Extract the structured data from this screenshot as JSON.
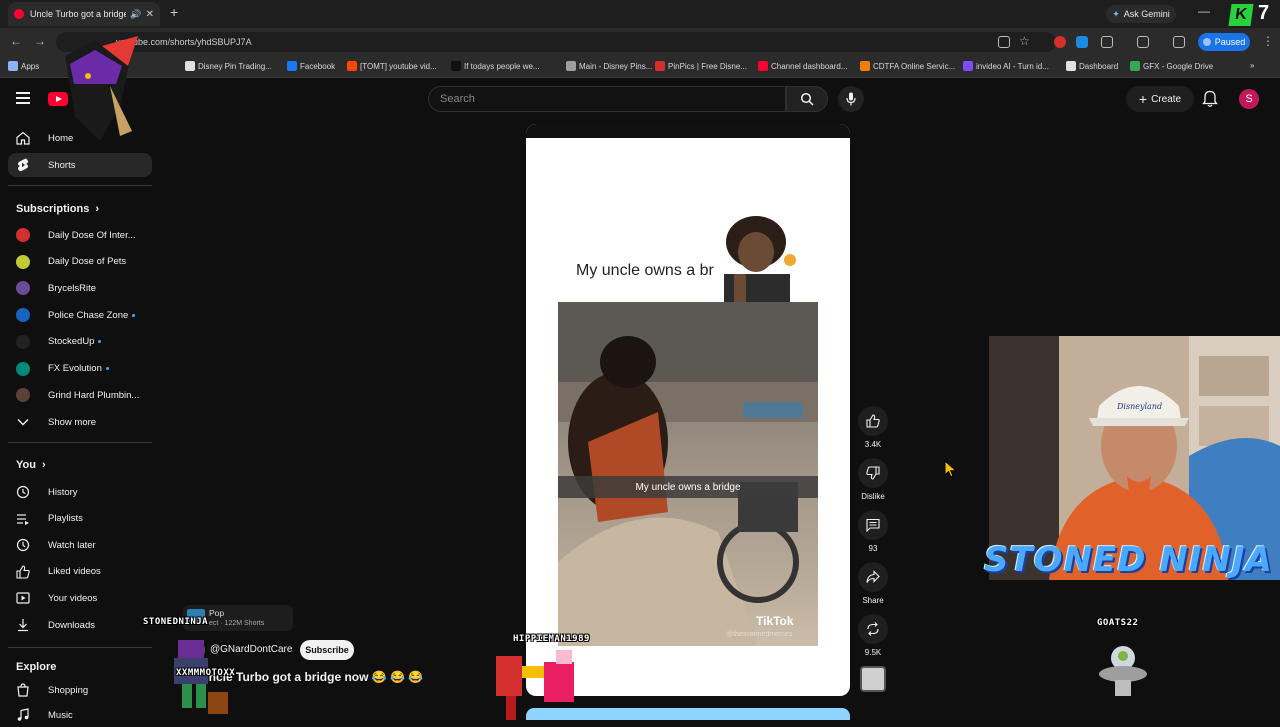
{
  "browser": {
    "tab_title": "Uncle Turbo got a bridge n",
    "new_tab": "+",
    "url": "youtube.com/shorts/yhdSBUPJ7A",
    "ask_gemini": "Ask Gemini",
    "paused_label": "Paused",
    "badge_letter": "K",
    "badge_number": "7"
  },
  "bookmarks": [
    {
      "label": "Apps",
      "color": "#8ab4f8"
    },
    {
      "label": "Disney Pin Trading...",
      "color": "#e0e0e0"
    },
    {
      "label": "Facebook",
      "color": "#1877f2"
    },
    {
      "label": "[TOMT] youtube vid...",
      "color": "#ff4500"
    },
    {
      "label": "If todays people we...",
      "color": "#111111"
    },
    {
      "label": "Main - Disney Pins...",
      "color": "#9e9e9e"
    },
    {
      "label": "PinPics | Free Disne...",
      "color": "#d32f2f"
    },
    {
      "label": "Channel dashboard...",
      "color": "#ff0033"
    },
    {
      "label": "CDTFA Online Servic...",
      "color": "#f57c00"
    },
    {
      "label": "invideo AI - Turn id...",
      "color": "#7c4dff"
    },
    {
      "label": "Dashboard",
      "color": "#e0e0e0"
    },
    {
      "label": "GFX - Google Drive",
      "color": "#34a853"
    }
  ],
  "masthead": {
    "search_placeholder": "Search",
    "create_label": "Create",
    "avatar_letter": "S"
  },
  "sidebar": {
    "main": [
      {
        "label": "Home"
      },
      {
        "label": "Shorts"
      }
    ],
    "subscriptions_header": "Subscriptions",
    "subscriptions": [
      {
        "label": "Daily Dose Of Inter...",
        "color": "#d32f2f",
        "new": false
      },
      {
        "label": "Daily Dose of Pets",
        "color": "#c0ca33",
        "new": false
      },
      {
        "label": "BrycelsRite",
        "color": "#6a4c93",
        "new": false
      },
      {
        "label": "Police Chase Zone",
        "color": "#1565c0",
        "new": true
      },
      {
        "label": "StockedUp",
        "color": "#222222",
        "new": true
      },
      {
        "label": "FX Evolution",
        "color": "#00897b",
        "new": true
      },
      {
        "label": "Grind Hard Plumbin...",
        "color": "#5d4037",
        "new": false
      }
    ],
    "show_more": "Show more",
    "you_header": "You",
    "you": [
      {
        "label": "History"
      },
      {
        "label": "Playlists"
      },
      {
        "label": "Watch later"
      },
      {
        "label": "Liked videos"
      },
      {
        "label": "Your videos"
      },
      {
        "label": "Downloads"
      }
    ],
    "explore_header": "Explore",
    "explore": [
      {
        "label": "Shopping"
      },
      {
        "label": "Music"
      }
    ]
  },
  "short": {
    "caption_top": "My uncle owns a br",
    "caption_strip": "My uncle owns a bridge",
    "watermark": "TikTok",
    "watermark_user": "@thescannedmemes",
    "title": "Uncle Turbo got a bridge now 😂 😂 😂",
    "channel_handle": "@GNardDontCare",
    "subscribe_label": "Subscribe",
    "pop_label": "Pop",
    "pop_sub": "ect · 122M Shorts"
  },
  "actions": [
    {
      "name": "like",
      "count": "3.4K"
    },
    {
      "name": "dislike",
      "count": "Dislike"
    },
    {
      "name": "comments",
      "count": "93"
    },
    {
      "name": "share",
      "count": "Share"
    },
    {
      "name": "remix",
      "count": "9.5K"
    }
  ],
  "overlays": {
    "stoned_ninja_small": "STONEDNINJA",
    "xxmmmotoxx": "XXMMMOTOXX",
    "hippieman": "HIPPIEMAN1989",
    "goats22": "GOATS22",
    "stoned_ninja_big": "STONED NINJA",
    "cap_text": "Disneyland"
  }
}
